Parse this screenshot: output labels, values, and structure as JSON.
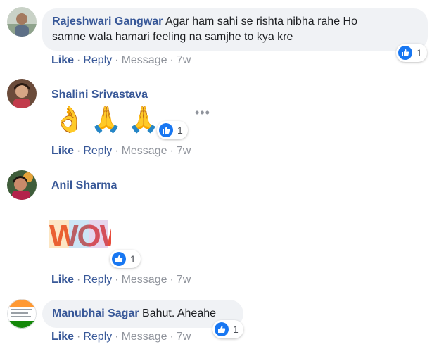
{
  "comments": [
    {
      "author": "Rajeshwari Gangwar",
      "text_line1": "Agar ham sahi se rishta nibha rahe Ho",
      "text_line2": "samne wala hamari feeling na samjhe to kya kre",
      "reactions": "1",
      "actions": {
        "like": "Like",
        "reply": "Reply",
        "message": "Message",
        "time": "7w"
      }
    },
    {
      "author": "Shalini Srivastava",
      "emojis": [
        "👌",
        "🙏",
        "🙏"
      ],
      "reactions": "1",
      "more": "•••",
      "actions": {
        "like": "Like",
        "reply": "Reply",
        "message": "Message",
        "time": "7w"
      }
    },
    {
      "author": "Anil Sharma",
      "sticker_text": "WOW",
      "reactions": "1",
      "actions": {
        "like": "Like",
        "reply": "Reply",
        "message": "Message",
        "time": "7w"
      }
    },
    {
      "author": "Manubhai Sagar",
      "text": "Bahut. Aheahe",
      "reactions": "1",
      "actions": {
        "like": "Like",
        "reply": "Reply",
        "message": "Message",
        "time": "7w"
      }
    }
  ],
  "colors": {
    "author": "#385898",
    "like_blue": "#1877f2",
    "bubble": "#f0f2f5",
    "muted": "#90949c"
  },
  "icons": {
    "like": "thumbs-up-icon",
    "more": "more-options-icon"
  }
}
